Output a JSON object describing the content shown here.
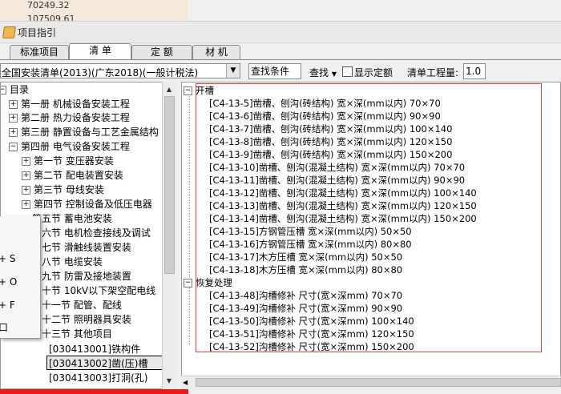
{
  "background": {
    "numbers": [
      "70249.32",
      "107509.61"
    ]
  },
  "window": {
    "title": "项目指引"
  },
  "tabs": [
    {
      "label": "标准项目"
    },
    {
      "label": "清 单"
    },
    {
      "label": "定 额"
    },
    {
      "label": "材 机"
    }
  ],
  "toolbar": {
    "catalog_select": "全国安装清单(2013)(广东2018)(一般计税法)",
    "condition_input": "查找条件",
    "find_label": "查找",
    "show_quota_label": "显示定额",
    "qty_label": "清单工程量:",
    "qty_value": "1.0"
  },
  "tree": {
    "root": "目录",
    "items": [
      {
        "label": "第一册  机械设备安装工程",
        "pm": "+"
      },
      {
        "label": "第二册  热力设备安装工程",
        "pm": "+"
      },
      {
        "label": "第三册  静置设备与工艺金属结构",
        "pm": "+"
      },
      {
        "label": "第四册  电气设备安装工程",
        "pm": "−"
      },
      {
        "label": "第一节  变压器安装",
        "pm": "+"
      },
      {
        "label": "第二节  配电装置安装",
        "pm": "+"
      },
      {
        "label": "第三节  母线安装",
        "pm": "+"
      },
      {
        "label": "第四节  控制设备及低压电器",
        "pm": "+"
      },
      {
        "label": "第五节  蓄电池安装",
        "pm": ""
      },
      {
        "label": "第六节  电机检查接线及调试",
        "pm": ""
      },
      {
        "label": "第七节  滑触线装置安装",
        "pm": ""
      },
      {
        "label": "第八节  电缆安装",
        "pm": ""
      },
      {
        "label": "第九节  防雷及接地装置",
        "pm": ""
      },
      {
        "label": "第十节  10kV以下架空配电线",
        "pm": ""
      },
      {
        "label": "第十一节  配管、配线",
        "pm": ""
      },
      {
        "label": "第十二节  照明器具安装",
        "pm": ""
      },
      {
        "label": "第十三节  其他项目",
        "pm": ""
      },
      {
        "label": "[030413001]铁构件",
        "pm": ""
      },
      {
        "label": "[030413002]凿(压)槽",
        "pm": ""
      },
      {
        "label": "[030413003]打洞(孔)",
        "pm": ""
      }
    ]
  },
  "popup": {
    "items": [
      "+ S",
      "+ O",
      "+ F",
      "口"
    ]
  },
  "right": {
    "group1": "开槽",
    "group1_items": [
      "[C4-13-5]凿槽、刨沟(砖结构) 宽×深(mm以内) 70×70",
      "[C4-13-6]凿槽、刨沟(砖结构) 宽×深(mm以内) 90×90",
      "[C4-13-7]凿槽、刨沟(砖结构) 宽×深(mm以内) 100×140",
      "[C4-13-8]凿槽、刨沟(砖结构) 宽×深(mm以内) 120×150",
      "[C4-13-9]凿槽、刨沟(砖结构) 宽×深(mm以内) 150×200",
      "[C4-13-10]凿槽、刨沟(混凝土结构) 宽×深(mm以内) 70×70",
      "[C4-13-11]凿槽、刨沟(混凝土结构) 宽×深(mm以内) 90×90",
      "[C4-13-12]凿槽、刨沟(混凝土结构) 宽×深(mm以内) 100×140",
      "[C4-13-13]凿槽、刨沟(混凝土结构) 宽×深(mm以内) 120×150",
      "[C4-13-14]凿槽、刨沟(混凝土结构) 宽×深(mm以内) 150×200",
      "[C4-13-15]方钢管压槽 宽×深(mm以内) 50×50",
      "[C4-13-16]方钢管压槽 宽×深(mm以内) 80×80",
      "[C4-13-17]木方压槽 宽×深(mm以内) 50×50",
      "[C4-13-18]木方压槽 宽×深(mm以内) 80×80"
    ],
    "group2": "恢复处理",
    "group2_items": [
      "[C4-13-48]沟槽修补 尺寸(宽×深mm) 70×70",
      "[C4-13-49]沟槽修补 尺寸(宽×深mm) 90×90",
      "[C4-13-50]沟槽修补 尺寸(宽×深mm) 100×140",
      "[C4-13-51]沟槽修补 尺寸(宽×深mm) 120×150",
      "[C4-13-52]沟槽修补 尺寸(宽×深mm) 150×200"
    ]
  }
}
